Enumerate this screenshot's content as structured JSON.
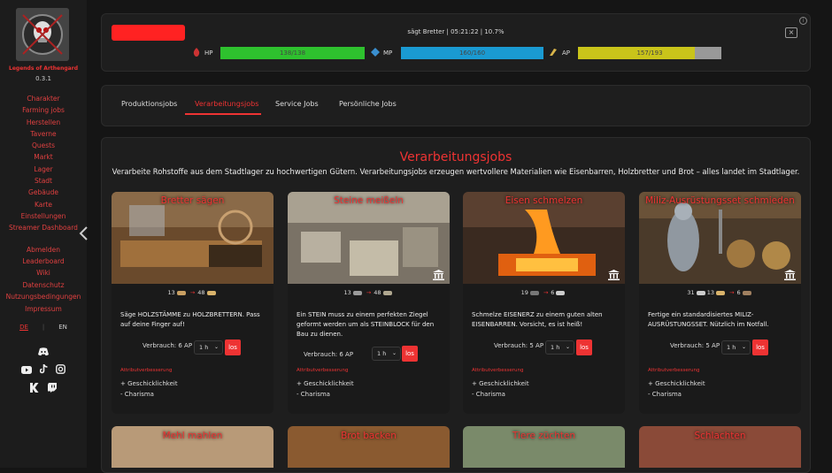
{
  "sidebar": {
    "brand": "Legends of Arthengard",
    "version": "0.3.1",
    "nav": [
      "Charakter",
      "Farming jobs",
      "Herstellen",
      "Taverne",
      "Quests",
      "Markt",
      "Lager",
      "Stadt",
      "Gebäude",
      "Karte",
      "Einstellungen",
      "Streamer Dashboard"
    ],
    "nav2": [
      "Abmelden",
      "Leaderboard",
      "Wiki",
      "Datenschutz",
      "Nutzungsbedingungen",
      "Impressum"
    ],
    "lang": [
      "DE",
      "EN"
    ],
    "social_icons": [
      "discord-icon",
      "youtube-icon",
      "tiktok-icon",
      "instagram-icon",
      "kick-icon",
      "twitch-icon"
    ]
  },
  "header": {
    "status": "sägt Bretter | 05:21:22 | 10.7%",
    "close": "×",
    "info": "i",
    "stats": [
      {
        "label": "HP",
        "text": "138/138",
        "fill": 1.0,
        "color": "#2ec12e"
      },
      {
        "label": "MP",
        "text": "160/160",
        "fill": 1.0,
        "color": "#1a9ad2"
      },
      {
        "label": "AP",
        "text": "157/193",
        "fill": 0.813,
        "color": "#c9c41a"
      }
    ]
  },
  "tabs": [
    "Produktionsjobs",
    "Verarbeitungsjobs",
    "Service Jobs",
    "Persönliche Jobs"
  ],
  "section": {
    "title": "Verarbeitungsjobs",
    "subtitle": "Verarbeite Rohstoffe aus dem Stadtlager zu hochwertigen Gütern. Verarbeitungsjobs erzeugen wertvollere Materialien wie Eisenbarren, Holzbretter und Brot – alles landet im Stadtlager."
  },
  "jobs": [
    {
      "name": "Bretter sägen",
      "in": "13",
      "out": "48",
      "in2": "",
      "desc": "Säge HOLZSTÄMME zu HOLZBRETTERN. Pass auf deine Finger auf!",
      "cost": "Verbrauch: 6 AP",
      "dur": "1 h",
      "btn": "los",
      "ah": "Attributverbesserung",
      "a1": "+ Geschicklichkeit",
      "a2": "- Charisma"
    },
    {
      "name": "Steine meißeln",
      "in": "13",
      "out": "48",
      "in2": "",
      "desc": "Ein STEIN muss zu einem perfekten Ziegel geformt werden um als STEINBLOCK für den Bau zu dienen.",
      "cost": "Verbrauch: 6 AP",
      "dur": "1 h",
      "btn": "los",
      "ah": "Attributverbesserung",
      "a1": "+ Geschicklichkeit",
      "a2": "- Charisma"
    },
    {
      "name": "Eisen schmelzen",
      "in": "19",
      "out": "6",
      "in2": "",
      "desc": "Schmelze EISENERZ zu einem guten alten EISENBARREN. Vorsicht, es ist heiß!",
      "cost": "Verbrauch: 5 AP",
      "dur": "1 h",
      "btn": "los",
      "ah": "Attributverbesserung",
      "a1": "+ Geschicklichkeit",
      "a2": "- Charisma"
    },
    {
      "name": "Miliz-Ausrüstungsset schmieden",
      "in": "31",
      "in2": "13",
      "out": "6",
      "desc": "Fertige ein standardisiertes MILIZ-AUSRÜSTUNGSSET. Nützlich im Notfall.",
      "cost": "Verbrauch: 5 AP",
      "dur": "1 h",
      "btn": "los",
      "ah": "Attributverbesserung",
      "a1": "+ Geschicklichkeit",
      "a2": "- Charisma"
    }
  ],
  "jobs2": [
    "Mehl mahlen",
    "Brot backen",
    "Tiere züchten",
    "Schlachten"
  ]
}
